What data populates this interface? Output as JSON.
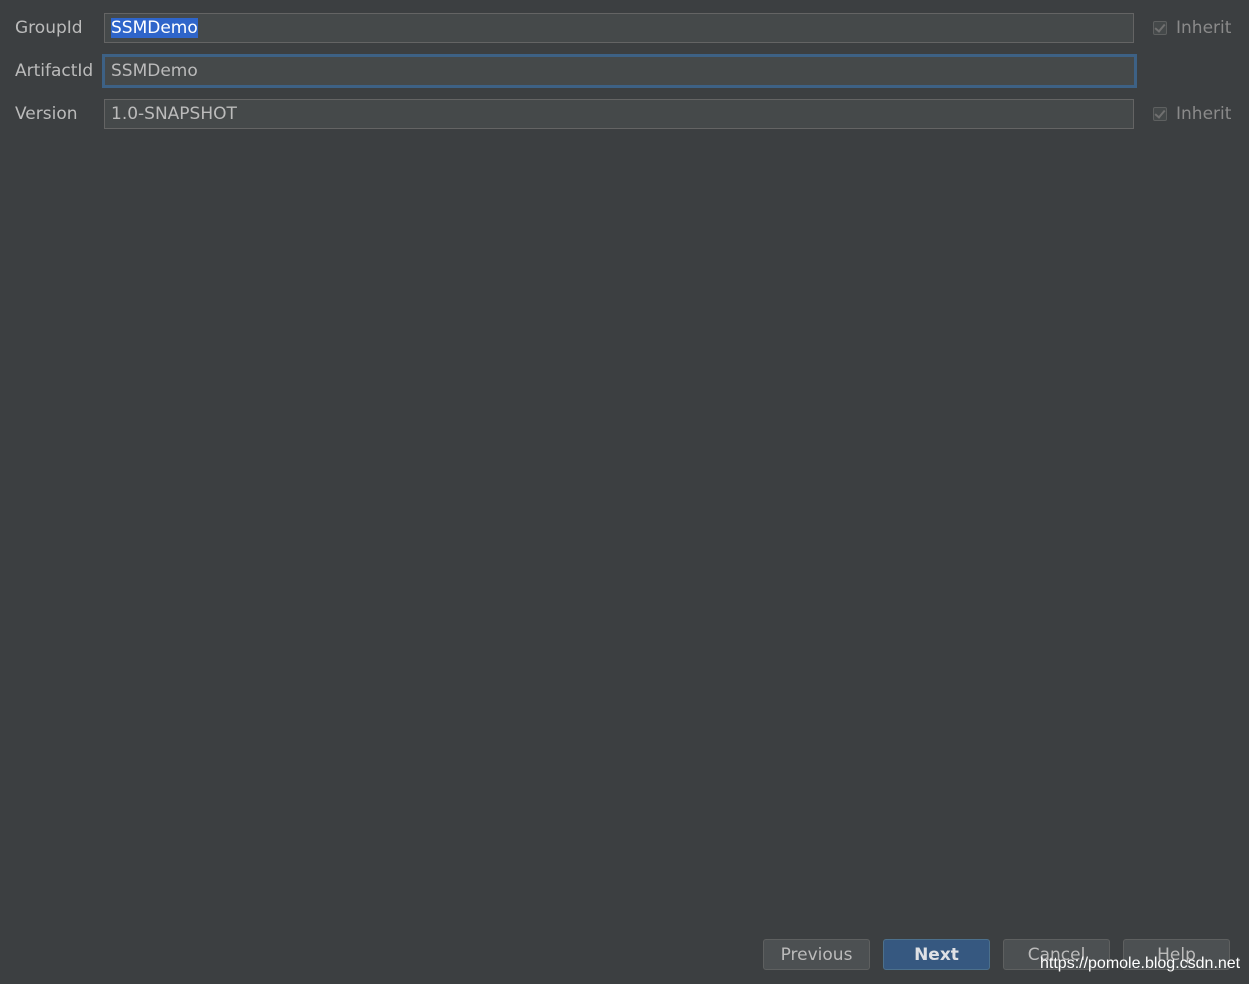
{
  "form": {
    "group_id": {
      "label": "GroupId",
      "value": "SSMDemo",
      "inherit_label": "Inherit",
      "inherit_checked": true
    },
    "artifact_id": {
      "label": "ArtifactId",
      "value": "SSMDemo"
    },
    "version": {
      "label": "Version",
      "value": "1.0-SNAPSHOT",
      "inherit_label": "Inherit",
      "inherit_checked": true
    }
  },
  "buttons": {
    "previous": "Previous",
    "next": "Next",
    "cancel": "Cancel",
    "help": "Help"
  },
  "watermark": "https://pomole.blog.csdn.net",
  "colors": {
    "background": "#3c3f41",
    "field": "#45494a",
    "focus_border": "#3d6185",
    "selection": "#2f65ca",
    "primary_button": "#365880"
  }
}
